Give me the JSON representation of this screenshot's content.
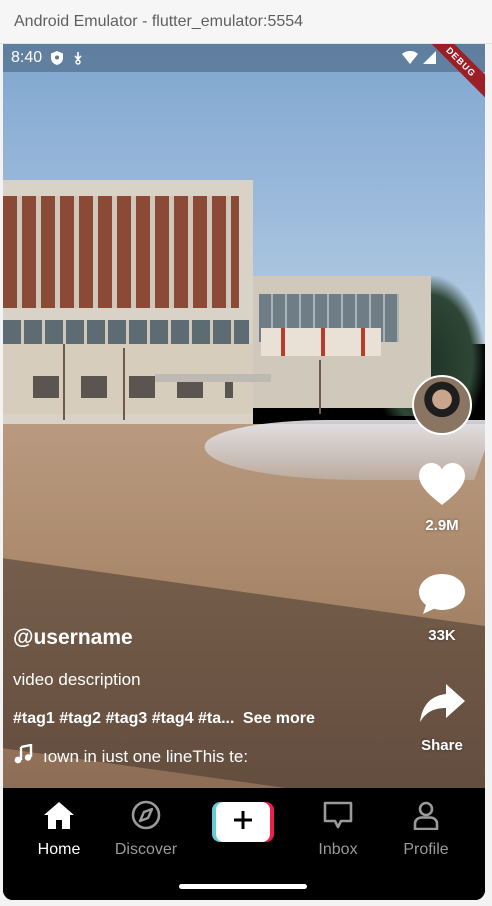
{
  "window": {
    "title": "Android Emulator - flutter_emulator:5554"
  },
  "status_bar": {
    "time": "8:40",
    "debug_label": "DEBUG"
  },
  "actions": {
    "likes": "2.9M",
    "comments": "33K",
    "share": "Share"
  },
  "post": {
    "username": "@username",
    "description": "video description",
    "tags": "#tag1 #tag2 #tag3 #tag4 #ta...",
    "see_more": "See more",
    "music": "ıown in iust one lineThis te:"
  },
  "nav": {
    "items": [
      {
        "label": "Home",
        "icon": "home-icon",
        "active": true
      },
      {
        "label": "Discover",
        "icon": "compass-icon",
        "active": false
      },
      {
        "label": "",
        "icon": "plus-icon",
        "active": false
      },
      {
        "label": "Inbox",
        "icon": "message-icon",
        "active": false
      },
      {
        "label": "Profile",
        "icon": "person-icon",
        "active": false
      }
    ]
  },
  "colors": {
    "create_cyan": "#69C9D0",
    "create_red": "#EE1D52",
    "nav_inactive": "#9A9A9A",
    "debug_ribbon": "#9C1F28"
  }
}
